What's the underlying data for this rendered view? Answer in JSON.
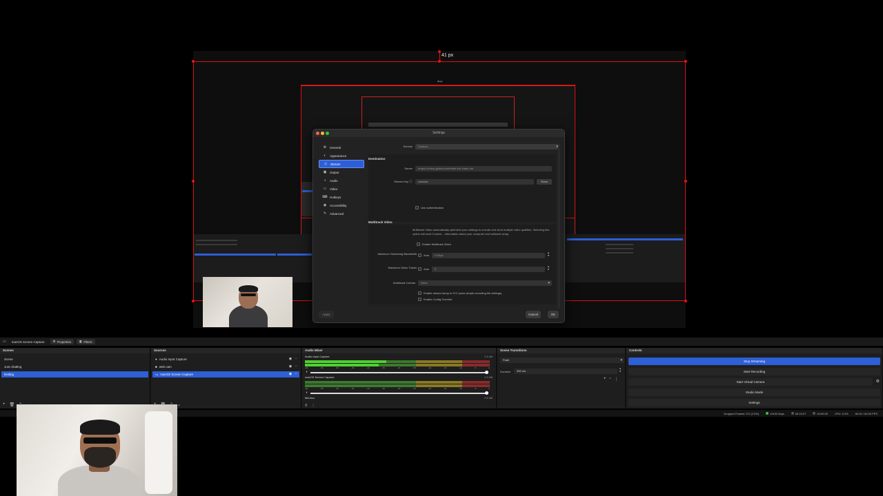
{
  "preview": {
    "px_label": "41 px",
    "mini_px_label": "41 px"
  },
  "settings": {
    "title": "Settings",
    "sidebar": [
      {
        "label": "General",
        "icon": "gear-icon",
        "glyph": "⚙"
      },
      {
        "label": "Appearance",
        "icon": "palette-icon",
        "glyph": "◐"
      },
      {
        "label": "Stream",
        "icon": "globe-icon",
        "glyph": "◎"
      },
      {
        "label": "Output",
        "icon": "output-icon",
        "glyph": "▣"
      },
      {
        "label": "Audio",
        "icon": "speaker-icon",
        "glyph": "◖"
      },
      {
        "label": "Video",
        "icon": "monitor-icon",
        "glyph": "▭"
      },
      {
        "label": "Hotkeys",
        "icon": "keyboard-icon",
        "glyph": "⌨"
      },
      {
        "label": "Accessibility",
        "icon": "accessibility-icon",
        "glyph": "◉"
      },
      {
        "label": "Advanced",
        "icon": "wrench-icon",
        "glyph": "✎"
      }
    ],
    "active_item": "Stream",
    "service_label": "Service",
    "service_value": "Custom...",
    "destination_title": "Destination",
    "server_label": "Server",
    "server_value": "rtmps://a.rtmp.global-contribute.live-video.net",
    "stream_key_label": "Stream Key",
    "stream_key_value": "••••••••••••••••••••••••••••••••••",
    "show_button": "Show",
    "use_auth_label": "Use authentication",
    "multitrack_title": "Multitrack Video",
    "multitrack_desc": "Multitrack Video automatically optimizes your settings to encode and send multiple video qualities. Selecting this option will send Custom... information about your computer and software setup.",
    "enable_multitrack_label": "Enable Multitrack Video",
    "max_bandwidth_label": "Maximum Streaming Bandwidth",
    "max_bandwidth_auto": "Auto",
    "max_bandwidth_value": "0 Kbps",
    "max_tracks_label": "Maximum Video Tracks",
    "max_tracks_auto": "Auto",
    "max_tracks_value": "0",
    "additional_canvas_label": "Additional Canvas",
    "additional_canvas_value": "None",
    "enable_dump_label": "Enable stream dump to FLV (uses simple recording file settings)",
    "enable_override_label": "Enable Config Override",
    "apply_button": "Apply",
    "cancel_button": "Cancel",
    "ok_button": "OK"
  },
  "context_bar": {
    "source_name": "macOS Screen Capture",
    "properties_button": "Properties",
    "filters_button": "Filters"
  },
  "scenes": {
    "title": "Scenes",
    "items": [
      "Scene",
      "Just chatting",
      "Ending"
    ],
    "selected": 2
  },
  "sources": {
    "title": "Sources",
    "items": [
      "Audio Input Capture",
      "web cam",
      "macOS Screen Capture"
    ],
    "selected": 2
  },
  "mixer": {
    "title": "Audio Mixer",
    "channels": [
      {
        "name": "Audio Input Capture",
        "db": "0.0 dB",
        "level": 0.44
      },
      {
        "name": "macOS Screen Capture",
        "db": "0.0 dB",
        "level": 0.0
      },
      {
        "name": "Mic/Aux",
        "db": "0.0 dB",
        "level": 0.0
      }
    ],
    "tick_labels": [
      "-60",
      "-55",
      "-50",
      "-45",
      "-40",
      "-35",
      "-30",
      "-25",
      "-20",
      "-15",
      "-10",
      "-5",
      "0"
    ]
  },
  "transitions": {
    "title": "Scene Transitions",
    "type_value": "Fade",
    "duration_label": "Duration",
    "duration_value": "300 ms"
  },
  "controls": {
    "title": "Controls",
    "buttons": [
      "Stop Streaming",
      "Start Recording",
      "Start Virtual Camera",
      "Studio Mode",
      "Settings"
    ]
  },
  "status": {
    "dropped": "Dropped Frames 721 (2.0%)",
    "bitrate": "10192 kbps",
    "stream_time": "00:10:27",
    "rec_time": "00:00:00",
    "cpu": "CPU: 5.4%",
    "fps": "60.00 / 60.00 FPS"
  },
  "colors": {
    "accent": "#2d5fd6",
    "guide_red": "#dd1111"
  }
}
